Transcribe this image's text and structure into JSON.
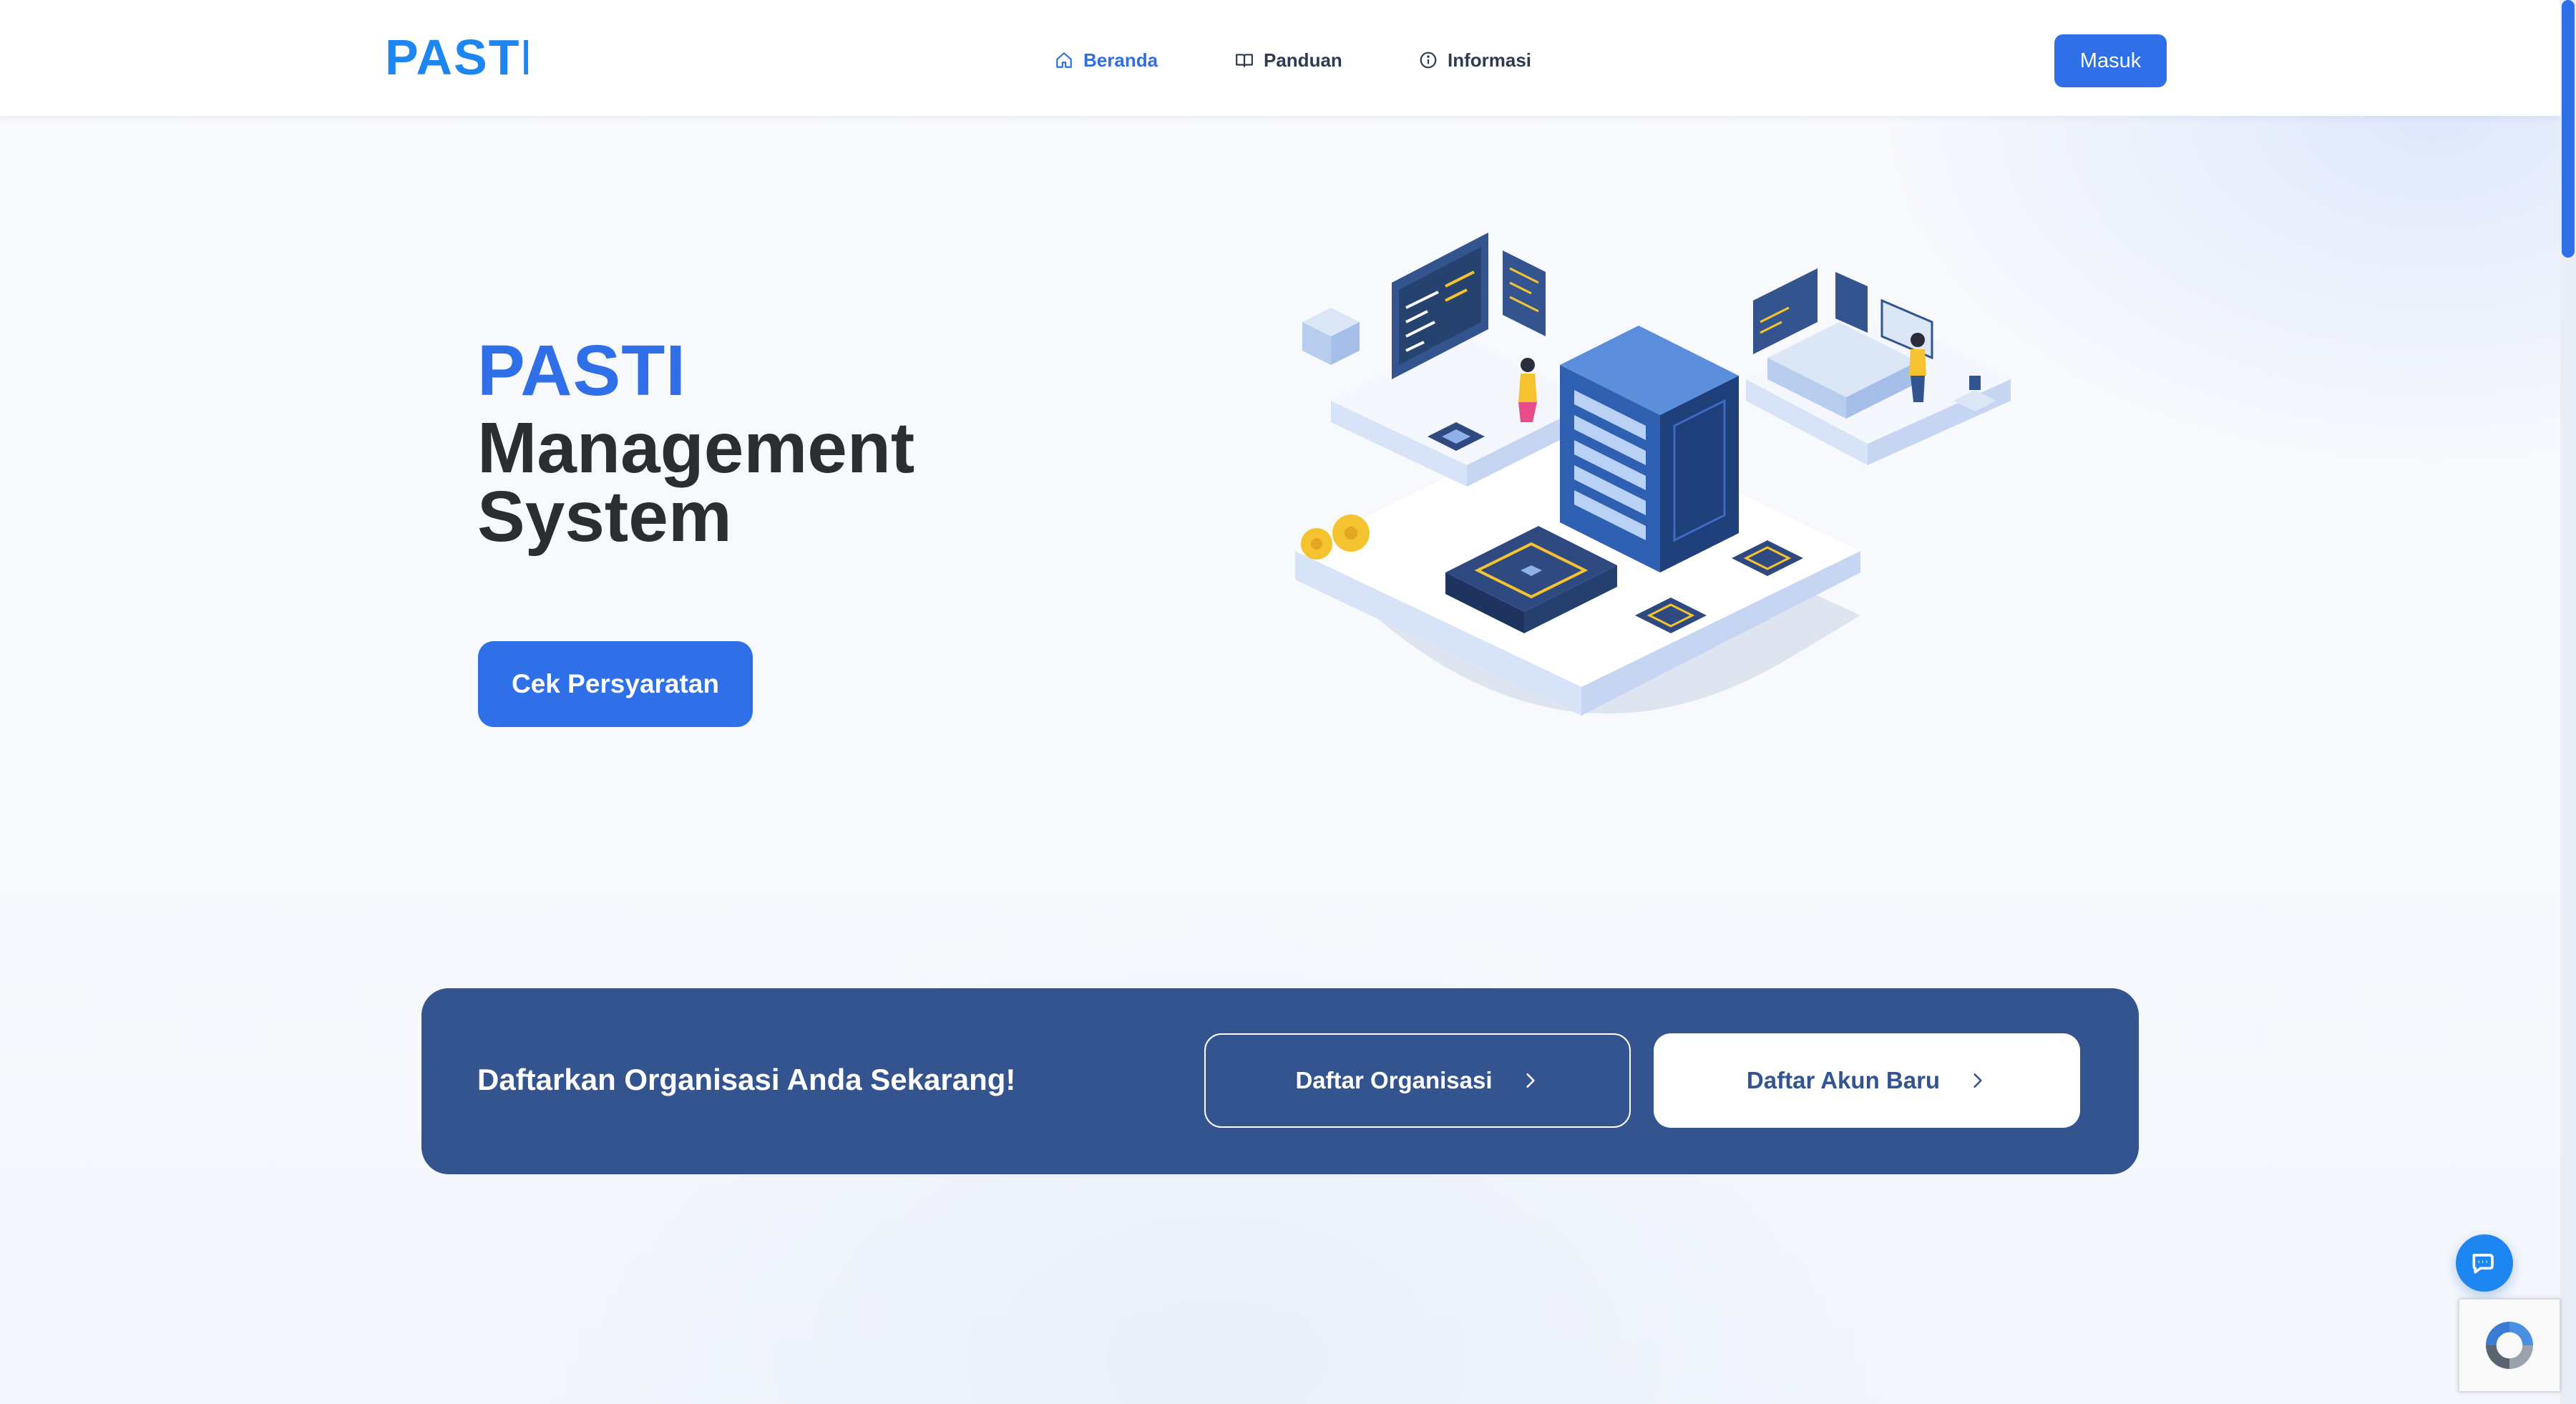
{
  "brand": {
    "logo_text": "PASTI",
    "primary_color": "#2f6fe8",
    "banner_color": "#33548f"
  },
  "nav": {
    "items": [
      {
        "label": "Beranda",
        "icon": "home-icon",
        "active": true
      },
      {
        "label": "Panduan",
        "icon": "book-icon",
        "active": false
      },
      {
        "label": "Informasi",
        "icon": "info-icon",
        "active": false
      }
    ],
    "login_label": "Masuk"
  },
  "hero": {
    "title_brand": "PASTI",
    "title_line1": "Management",
    "title_line2": "System",
    "cta_label": "Cek Persyaratan",
    "illustration": "isometric-server-room-illustration"
  },
  "banner": {
    "text": "Daftarkan Organisasi Anda Sekarang!",
    "register_org_label": "Daftar Organisasi",
    "register_account_label": "Daftar Akun Baru",
    "chevron_icon": "chevron-right-icon"
  },
  "widgets": {
    "chat_icon": "chat-bubble-icon",
    "recaptcha_icon": "recaptcha-icon"
  }
}
